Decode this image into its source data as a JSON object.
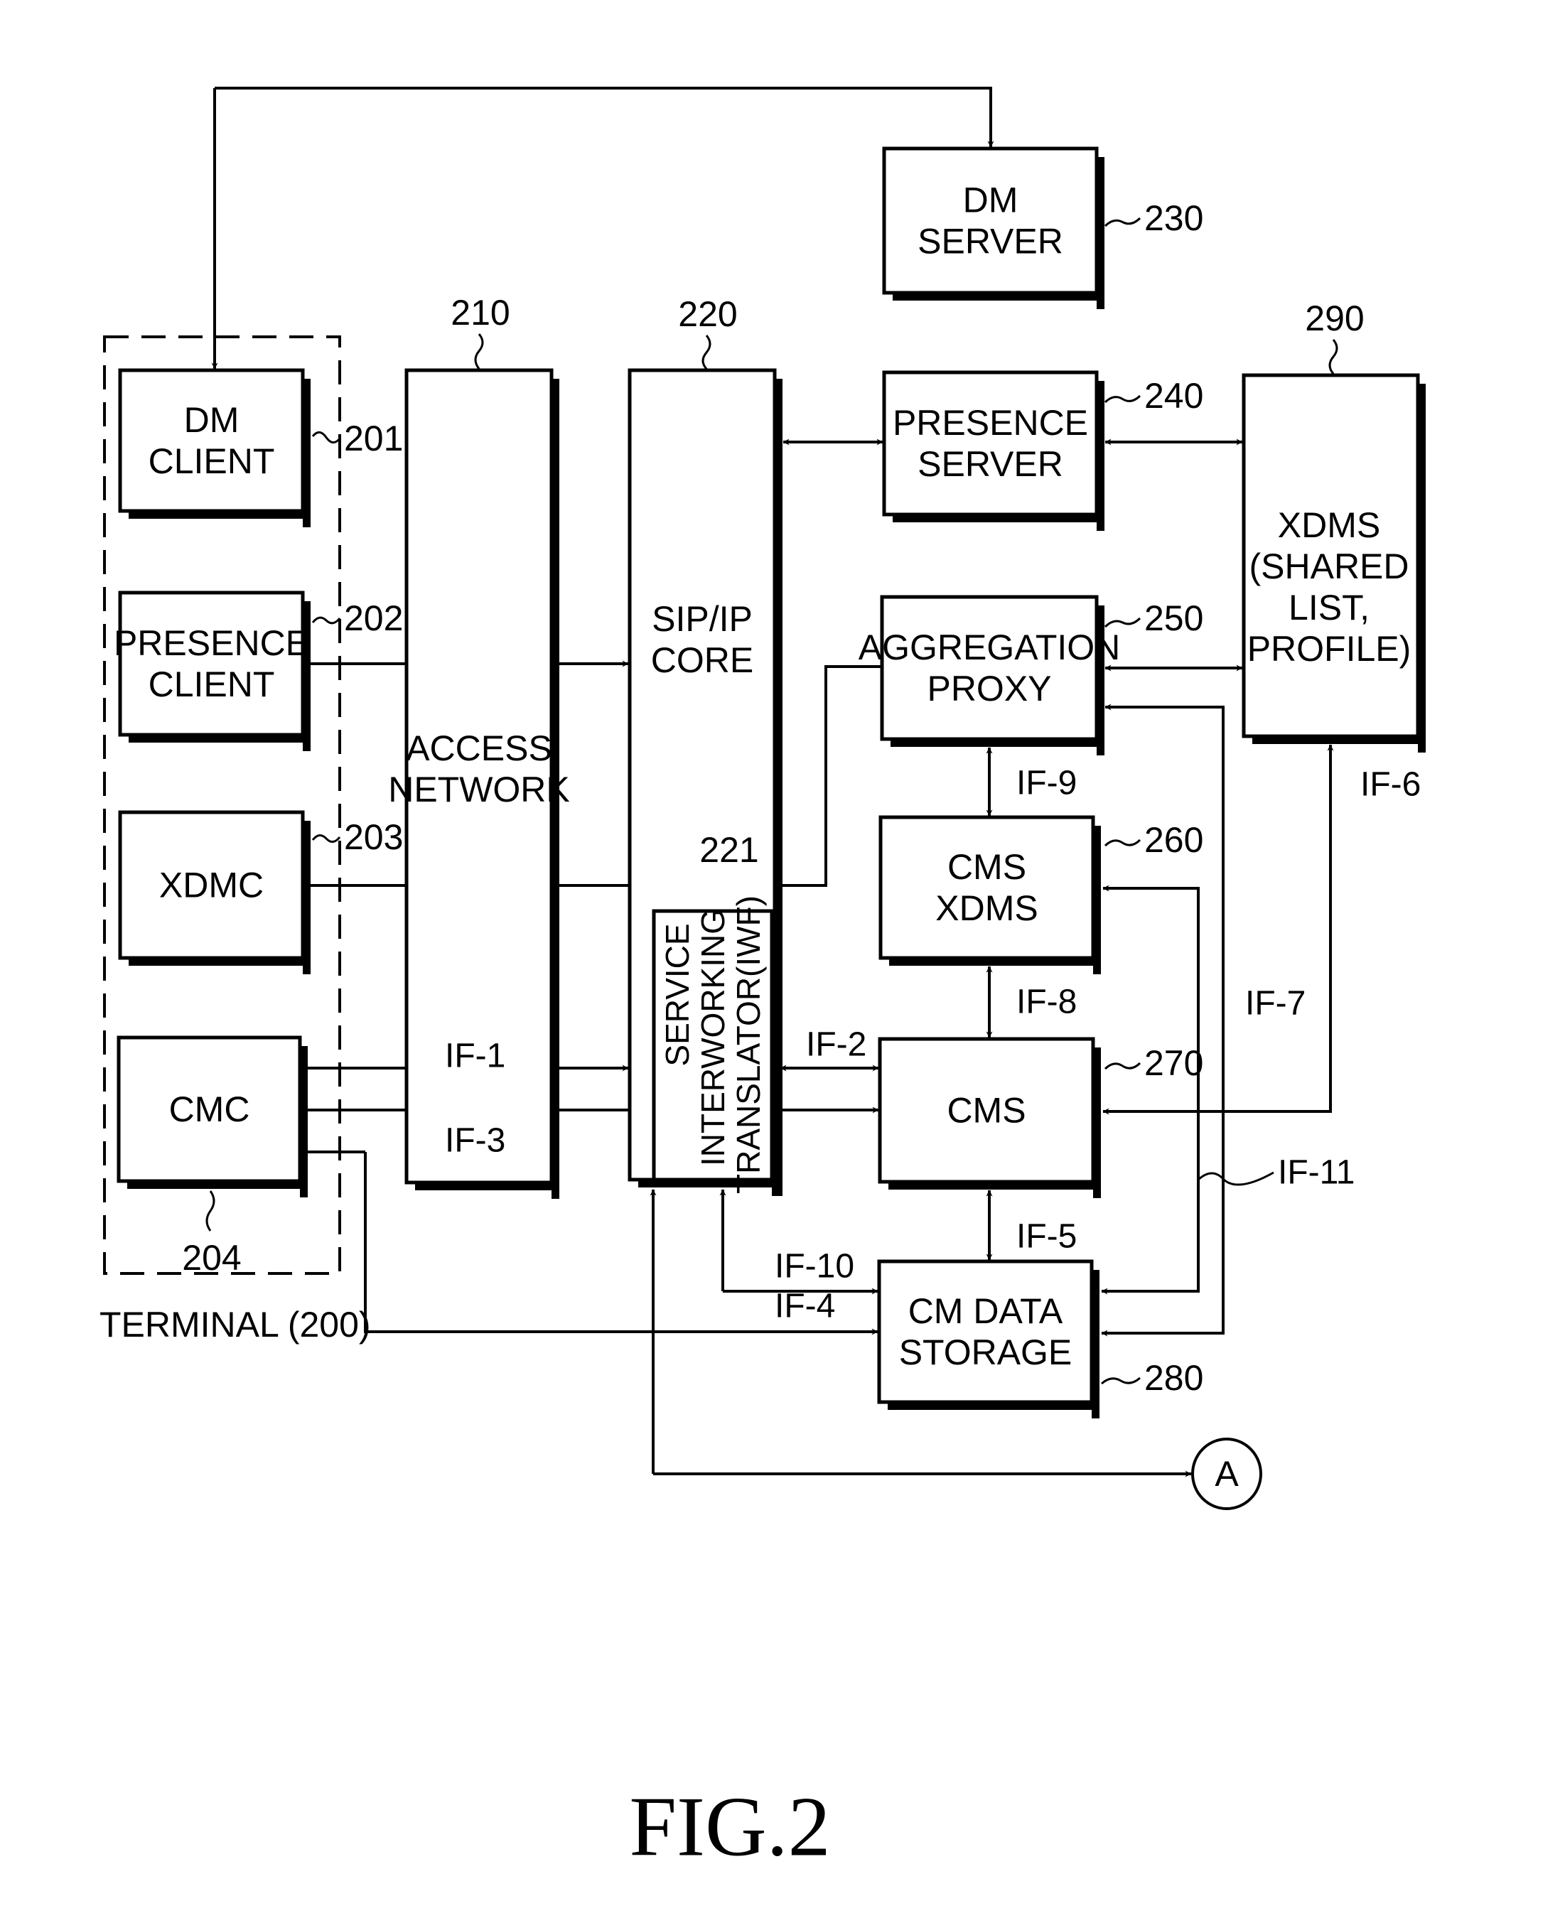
{
  "figure": {
    "caption": "FIG.2",
    "terminal_label": "TERMINAL (200)",
    "connector_label": "A"
  },
  "blocks": {
    "dm_client": {
      "lines": [
        "DM",
        "CLIENT"
      ],
      "ref": "201"
    },
    "presence_client": {
      "lines": [
        "PRESENCE",
        "CLIENT"
      ],
      "ref": "202"
    },
    "xdmc": {
      "lines": [
        "XDMC"
      ],
      "ref": "203"
    },
    "cmc": {
      "lines": [
        "CMC"
      ],
      "ref": "204"
    },
    "access_network": {
      "lines": [
        "ACCESS",
        "NETWORK"
      ],
      "ref": "210"
    },
    "sip_ip_core": {
      "lines": [
        "SIP/IP",
        "CORE"
      ],
      "ref": "220"
    },
    "iwf": {
      "lines": [
        "SERVICE",
        "INTERWORKING",
        "TRANSLATOR(IWF)"
      ],
      "ref": "221"
    },
    "dm_server": {
      "lines": [
        "DM",
        "SERVER"
      ],
      "ref": "230"
    },
    "presence_server": {
      "lines": [
        "PRESENCE",
        "SERVER"
      ],
      "ref": "240"
    },
    "aggregation_proxy": {
      "lines": [
        "AGGREGATION",
        "PROXY"
      ],
      "ref": "250"
    },
    "cms_xdms": {
      "lines": [
        "CMS",
        "XDMS"
      ],
      "ref": "260"
    },
    "cms": {
      "lines": [
        "CMS"
      ],
      "ref": "270"
    },
    "cm_data_storage": {
      "lines": [
        "CM DATA",
        "STORAGE"
      ],
      "ref": "280"
    },
    "xdms_shared": {
      "lines": [
        "XDMS",
        "(SHARED",
        "LIST,",
        "PROFILE)"
      ],
      "ref": "290"
    }
  },
  "interfaces": {
    "if1": "IF-1",
    "if2": "IF-2",
    "if3": "IF-3",
    "if4": "IF-4",
    "if5": "IF-5",
    "if6": "IF-6",
    "if7": "IF-7",
    "if8": "IF-8",
    "if9": "IF-9",
    "if10": "IF-10",
    "if11": "IF-11"
  }
}
